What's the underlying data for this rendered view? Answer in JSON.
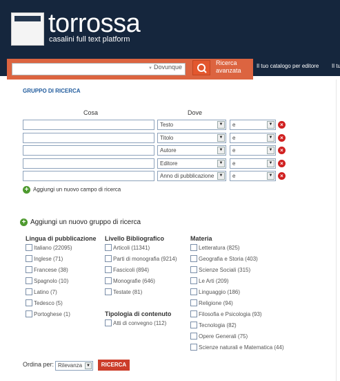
{
  "brand": {
    "title": "torrossa",
    "subtitle": "casalini full text platform"
  },
  "search": {
    "query": "",
    "scope": "Dovunque",
    "advanced_label": "Ricerca avanzata",
    "nav": [
      "Il tuo catalogo per editore",
      "Il tu"
    ]
  },
  "group": {
    "title": "GRUPPO DI RICERCA",
    "col_cosa": "Cosa",
    "col_dove": "Dove"
  },
  "rows": [
    {
      "term": "",
      "field": "Testo",
      "op": "e"
    },
    {
      "term": "",
      "field": "Titolo",
      "op": "e"
    },
    {
      "term": "",
      "field": "Autore",
      "op": "e"
    },
    {
      "term": "",
      "field": "Editore",
      "op": "e"
    },
    {
      "term": "",
      "field": "Anno di pubblicazione",
      "op": "e"
    }
  ],
  "add_field_label": "Aggiungi un nuovo campo di ricerca",
  "add_group_label": "Aggiungi un nuovo gruppo di ricerca",
  "facets": {
    "lingua": {
      "title": "Lingua di pubblicazione",
      "items": [
        "Italiano (22095)",
        "Inglese (71)",
        "Francese (38)",
        "Spagnolo (10)",
        "Latino (7)",
        "Tedesco (5)",
        "Portoghese (1)"
      ]
    },
    "livello": {
      "title": "Livello Bibliografico",
      "items": [
        "Articoli (11341)",
        "Parti di monografia (9214)",
        "Fascicoli (894)",
        "Monografie (646)",
        "Testate (81)"
      ]
    },
    "tipologia": {
      "title": "Tipologia di contenuto",
      "items": [
        "Atti di convegno (112)"
      ]
    },
    "materia": {
      "title": "Materia",
      "items": [
        "Letteratura (825)",
        "Geografia e Storia (403)",
        "Scienze Sociali (315)",
        "Le Arti (209)",
        "Linguaggio (186)",
        "Religione (94)",
        "Filosofia e Psicologia (93)",
        "Tecnologia (82)",
        "Opere Generali (75)",
        "Scienze naturali e Matematica (44)"
      ]
    }
  },
  "order": {
    "label": "Ordina per:",
    "value": "Rilevanza",
    "button": "RICERCA"
  },
  "colors": {
    "header_bg": "#15263d",
    "accent_orange": "#dc6440",
    "link_blue": "#1f5a9c",
    "delete_red": "#d02020",
    "add_green": "#4e9a2f"
  }
}
